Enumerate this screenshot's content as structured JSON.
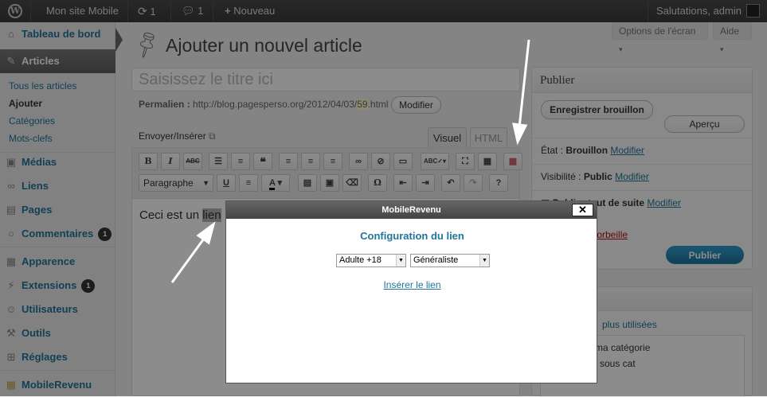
{
  "adminbar": {
    "site_name": "Mon site Mobile",
    "updates_count": "1",
    "comments_count": "1",
    "new_label": "Nouveau",
    "greeting": "Salutations, admin"
  },
  "sidebar": {
    "dashboard": "Tableau de bord",
    "articles": "Articles",
    "sub_all": "Tous les articles",
    "sub_add": "Ajouter",
    "sub_categories": "Catégories",
    "sub_tags": "Mots-clefs",
    "media": "Médias",
    "links": "Liens",
    "pages": "Pages",
    "comments": "Commentaires",
    "comments_badge": "1",
    "appearance": "Apparence",
    "extensions": "Extensions",
    "extensions_badge": "1",
    "users": "Utilisateurs",
    "tools": "Outils",
    "settings": "Réglages",
    "mobilerevenu": "MobileRevenu"
  },
  "screen_options": {
    "screen_label": "Options de l'écran",
    "help_label": "Aide"
  },
  "page": {
    "title": "Ajouter un nouvel article",
    "title_placeholder": "Saisissez le titre ici",
    "permalink_label": "Permalien :",
    "permalink_url_prefix": "http://blog.pagesperso.org/2012/04/03/",
    "permalink_slug": "59",
    "permalink_url_suffix": ".html",
    "modify_button": "Modifier",
    "upload_label": "Envoyer/Insérer",
    "tab_visual": "Visuel",
    "tab_html": "HTML",
    "format_select": "Paragraphe",
    "content_before": "Ceci est un ",
    "content_selected": "lien"
  },
  "publish_box": {
    "title": "Publier",
    "save_draft": "Enregistrer brouillon",
    "preview": "Aperçu",
    "status_label": "État :",
    "status_value": "Brouillon",
    "status_modify": "Modifier",
    "visibility_label": "Visibilité :",
    "visibility_value": "Public",
    "visibility_modify": "Modifier",
    "schedule_text": "Publier tout de suite",
    "schedule_modify": "Modifier",
    "trash_text": "la Corbeille",
    "publish_button": "Publier"
  },
  "categories_box": {
    "most_used": "plus utilisées",
    "item1": "ma catégorie",
    "item2": "sous cat"
  },
  "modal": {
    "window_title": "MobileRevenu",
    "close_symbol": "✕",
    "heading": "Configuration du lien",
    "select1_value": "Adulte +18",
    "select2_value": "Généraliste",
    "insert_link": "Insérer le lien"
  },
  "colors": {
    "accent": "#21759b",
    "adminbar": "#464646",
    "overlay": "rgba(0,0,0,0.45)"
  }
}
